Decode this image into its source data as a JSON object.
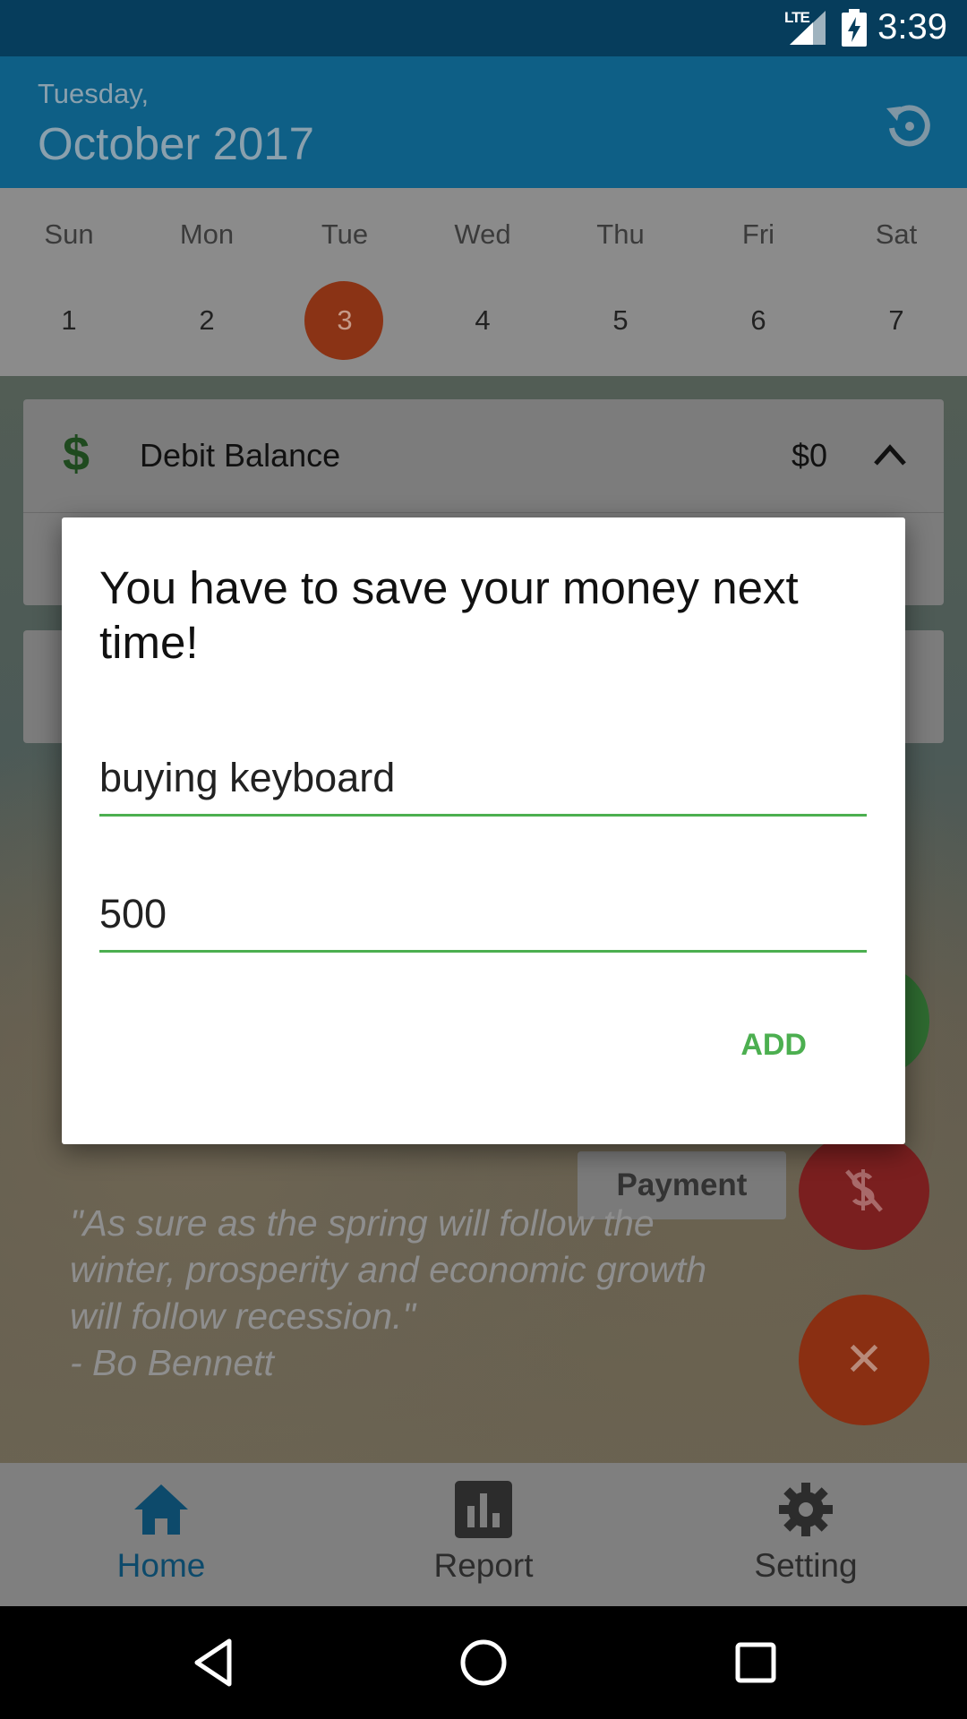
{
  "status_bar": {
    "network": "LTE",
    "time": "3:39"
  },
  "header": {
    "day": "Tuesday,",
    "month_year": "October 2017"
  },
  "week": {
    "days": [
      {
        "name": "Sun",
        "num": "1"
      },
      {
        "name": "Mon",
        "num": "2"
      },
      {
        "name": "Tue",
        "num": "3"
      },
      {
        "name": "Wed",
        "num": "4"
      },
      {
        "name": "Thu",
        "num": "5"
      },
      {
        "name": "Fri",
        "num": "6"
      },
      {
        "name": "Sat",
        "num": "7"
      }
    ],
    "selected": "3"
  },
  "balance_card": {
    "symbol": "$",
    "title": "Debit Balance",
    "amount": "$0"
  },
  "payment_button": "Payment",
  "quote": {
    "line1": "\"As sure as the spring will follow the",
    "line2": "winter, prosperity and economic growth",
    "line3": "will follow recession.\"",
    "author": "- Bo Bennett"
  },
  "bottom_nav": {
    "home": "Home",
    "report": "Report",
    "setting": "Setting"
  },
  "dialog": {
    "title": "You have to save your money next time!",
    "description_value": "buying keyboard",
    "amount_value": "500",
    "add_label": "ADD"
  },
  "colors": {
    "accent_green": "#4caf50",
    "primary": "#0e5f86",
    "fab_red": "#e64a19"
  }
}
